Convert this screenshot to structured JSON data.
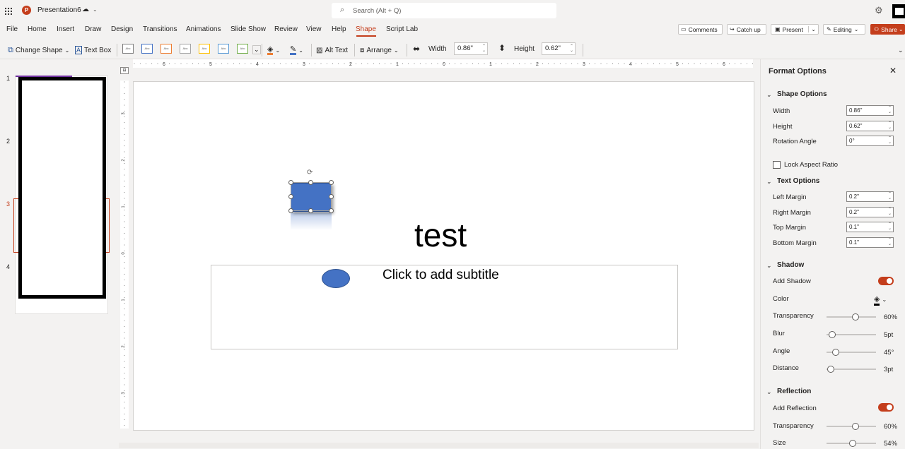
{
  "app": {
    "title": "Presentation6",
    "search_placeholder": "Search (Alt + Q)"
  },
  "menu": {
    "items": [
      "File",
      "Home",
      "Insert",
      "Draw",
      "Design",
      "Transitions",
      "Animations",
      "Slide Show",
      "Review",
      "View",
      "Help",
      "Shape",
      "Script Lab"
    ],
    "active": "Shape",
    "comments": "Comments",
    "catch_up": "Catch up",
    "present": "Present",
    "editing": "Editing",
    "share": "Share"
  },
  "ribbon": {
    "change_shape": "Change Shape",
    "text_box": "Text Box",
    "alt_text": "Alt Text",
    "arrange": "Arrange",
    "width_label": "Width",
    "width_value": "0.86\"",
    "height_label": "Height",
    "height_value": "0.62\"",
    "style_swatch": "Abc"
  },
  "slides": {
    "numbers": [
      "1",
      "2",
      "3",
      "4"
    ],
    "selected": "3"
  },
  "ruler": {
    "h_labels": [
      "6",
      "5",
      "4",
      "3",
      "2",
      "1",
      "0",
      "1",
      "2",
      "3",
      "4",
      "5",
      "6"
    ],
    "v_labels": [
      "3",
      "2",
      "1",
      "0",
      "1",
      "2",
      "3"
    ]
  },
  "slide": {
    "title": "test",
    "subtitle": "Click to add subtitle"
  },
  "panel": {
    "title": "Format Options",
    "shape_options": {
      "header": "Shape Options",
      "width_label": "Width",
      "width_value": "0.86\"",
      "height_label": "Height",
      "height_value": "0.62\"",
      "rotation_label": "Rotation Angle",
      "rotation_value": "0°",
      "lock_label": "Lock Aspect Ratio"
    },
    "text_options": {
      "header": "Text Options",
      "left_label": "Left Margin",
      "left_value": "0.2\"",
      "right_label": "Right Margin",
      "right_value": "0.2\"",
      "top_label": "Top Margin",
      "top_value": "0.1\"",
      "bottom_label": "Bottom Margin",
      "bottom_value": "0.1\""
    },
    "shadow": {
      "header": "Shadow",
      "add_label": "Add Shadow",
      "color_label": "Color",
      "transparency_label": "Transparency",
      "transparency_value": "60%",
      "transparency_level": 0.6,
      "blur_label": "Blur",
      "blur_value": "5pt",
      "blur_level": 0.05,
      "angle_label": "Angle",
      "angle_value": "45°",
      "angle_level": 0.125,
      "distance_label": "Distance",
      "distance_value": "3pt",
      "distance_level": 0.02
    },
    "reflection": {
      "header": "Reflection",
      "add_label": "Add Reflection",
      "transparency_label": "Transparency",
      "transparency_value": "60%",
      "transparency_level": 0.6,
      "size_label": "Size",
      "size_value": "54%",
      "size_level": 0.54
    }
  },
  "colors": {
    "accent": "#c43e1c",
    "shape_fill": "#4472c4"
  }
}
